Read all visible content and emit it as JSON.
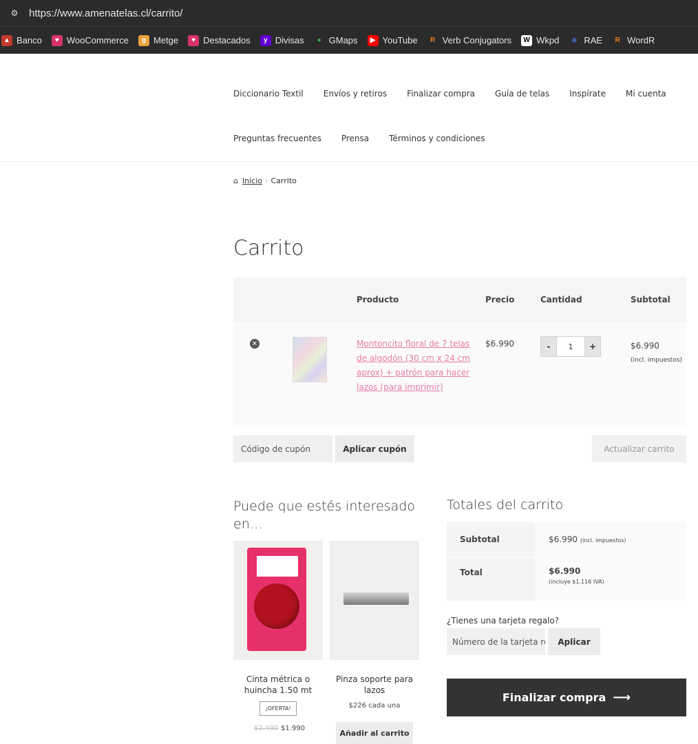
{
  "browser": {
    "url": "https://www.amenatelas.cl/carrito/",
    "bookmarks": [
      {
        "label": "Banco",
        "icon": "bank-icon"
      },
      {
        "label": "WooCommerce",
        "icon": "heart-icon"
      },
      {
        "label": "Metge",
        "icon": "gencat-icon"
      },
      {
        "label": "Destacados",
        "icon": "heart-icon"
      },
      {
        "label": "Divisas",
        "icon": "yahoo-icon"
      },
      {
        "label": "GMaps",
        "icon": "maps-pin-icon"
      },
      {
        "label": "YouTube",
        "icon": "youtube-icon"
      },
      {
        "label": "Verb Conjugators",
        "icon": "reverso-icon"
      },
      {
        "label": "Wkpd",
        "icon": "wikipedia-icon"
      },
      {
        "label": "RAE",
        "icon": "rae-icon"
      },
      {
        "label": "WordR",
        "icon": "reverso-icon"
      }
    ]
  },
  "nav": {
    "row1": [
      "Diccionario Textil",
      "Envíos y retiros",
      "Finalizar compra",
      "Guía de telas",
      "Inspírate",
      "Mi cuenta"
    ],
    "row2": [
      "Preguntas frecuentes",
      "Prensa",
      "Términos y condiciones"
    ]
  },
  "breadcrumb": {
    "home": "Inicio",
    "separator": "›",
    "current": "Carrito"
  },
  "page_title": "Carrito",
  "cart": {
    "headers": {
      "product": "Producto",
      "price": "Precio",
      "quantity": "Cantidad",
      "subtotal": "Subtotal"
    },
    "items": [
      {
        "name": "Montoncito floral de 7 telas de algodón (30 cm x 24 cm aprox) + patrón para hacer lazos (para imprimir)",
        "price": "$6.990",
        "quantity": "1",
        "subtotal": "$6.990",
        "subtotal_note": "(incl. impuestos)"
      }
    ],
    "qty_minus": "-",
    "qty_plus": "+",
    "coupon_placeholder": "Código de cupón",
    "apply_coupon": "Aplicar cupón",
    "update_cart": "Actualizar carrito"
  },
  "cross_sells": {
    "title": "Puede que estés interesado en…",
    "items": [
      {
        "name": "Cinta métrica o huincha 1.50 mt",
        "badge": "¡OFERTA!",
        "old_price": "$2.490",
        "price": "$1.990"
      },
      {
        "name": "Pinza soporte para lazos",
        "price": "$226 cada una",
        "button": "Añadir al carrito"
      }
    ]
  },
  "totals": {
    "title": "Totales del carrito",
    "subtotal_label": "Subtotal",
    "subtotal_value": "$6.990",
    "subtotal_note": "(incl. impuestos)",
    "total_label": "Total",
    "total_value": "$6.990",
    "total_note": "(incluye $1.116 IVA)",
    "gift_question": "¿Tienes una tarjeta regalo?",
    "gift_placeholder": "Número de la tarjeta re",
    "gift_apply": "Aplicar",
    "checkout": "Finalizar compra",
    "checkout_arrow": "⟶"
  },
  "colors": {
    "link_pink": "#e87aa7",
    "checkout_bg": "#333333",
    "browser_bg": "#2b2b2b"
  }
}
